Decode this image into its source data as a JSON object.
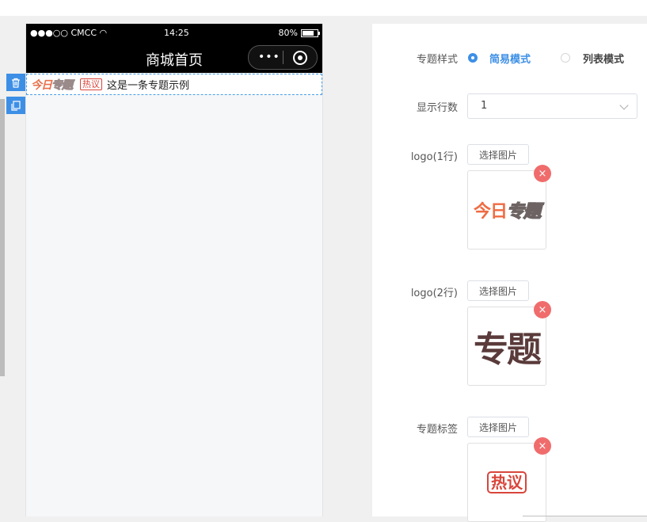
{
  "phone": {
    "status": {
      "carrier": "●●●○○ CMCC",
      "time": "14:25",
      "battery": "80%"
    },
    "nav_title": "商城首页",
    "capsule_dots": "•••",
    "topic": {
      "logo_part1": "今日",
      "logo_part2": "专题",
      "tag": "热议",
      "text": "这是一条专题示例"
    }
  },
  "controls": {
    "delete_icon": "trash-icon",
    "copy_icon": "copy-icon"
  },
  "settings": {
    "style_label": "专题样式",
    "style_options": [
      {
        "label": "简易模式",
        "selected": true
      },
      {
        "label": "列表模式",
        "selected": false
      }
    ],
    "rows_label": "显示行数",
    "rows_value": "1",
    "logo1_label": "logo(1行)",
    "logo2_label": "logo(2行)",
    "tag_label": "专题标签",
    "choose_image": "选择图片",
    "logo1_preview": {
      "part1": "今日",
      "part2": "专题"
    },
    "logo2_preview": "专题",
    "tag_preview": "热议",
    "remove_symbol": "×"
  },
  "colors": {
    "accent": "#3d8fe6",
    "danger": "#f06c6c",
    "logo_orange": "#ef6b42"
  }
}
